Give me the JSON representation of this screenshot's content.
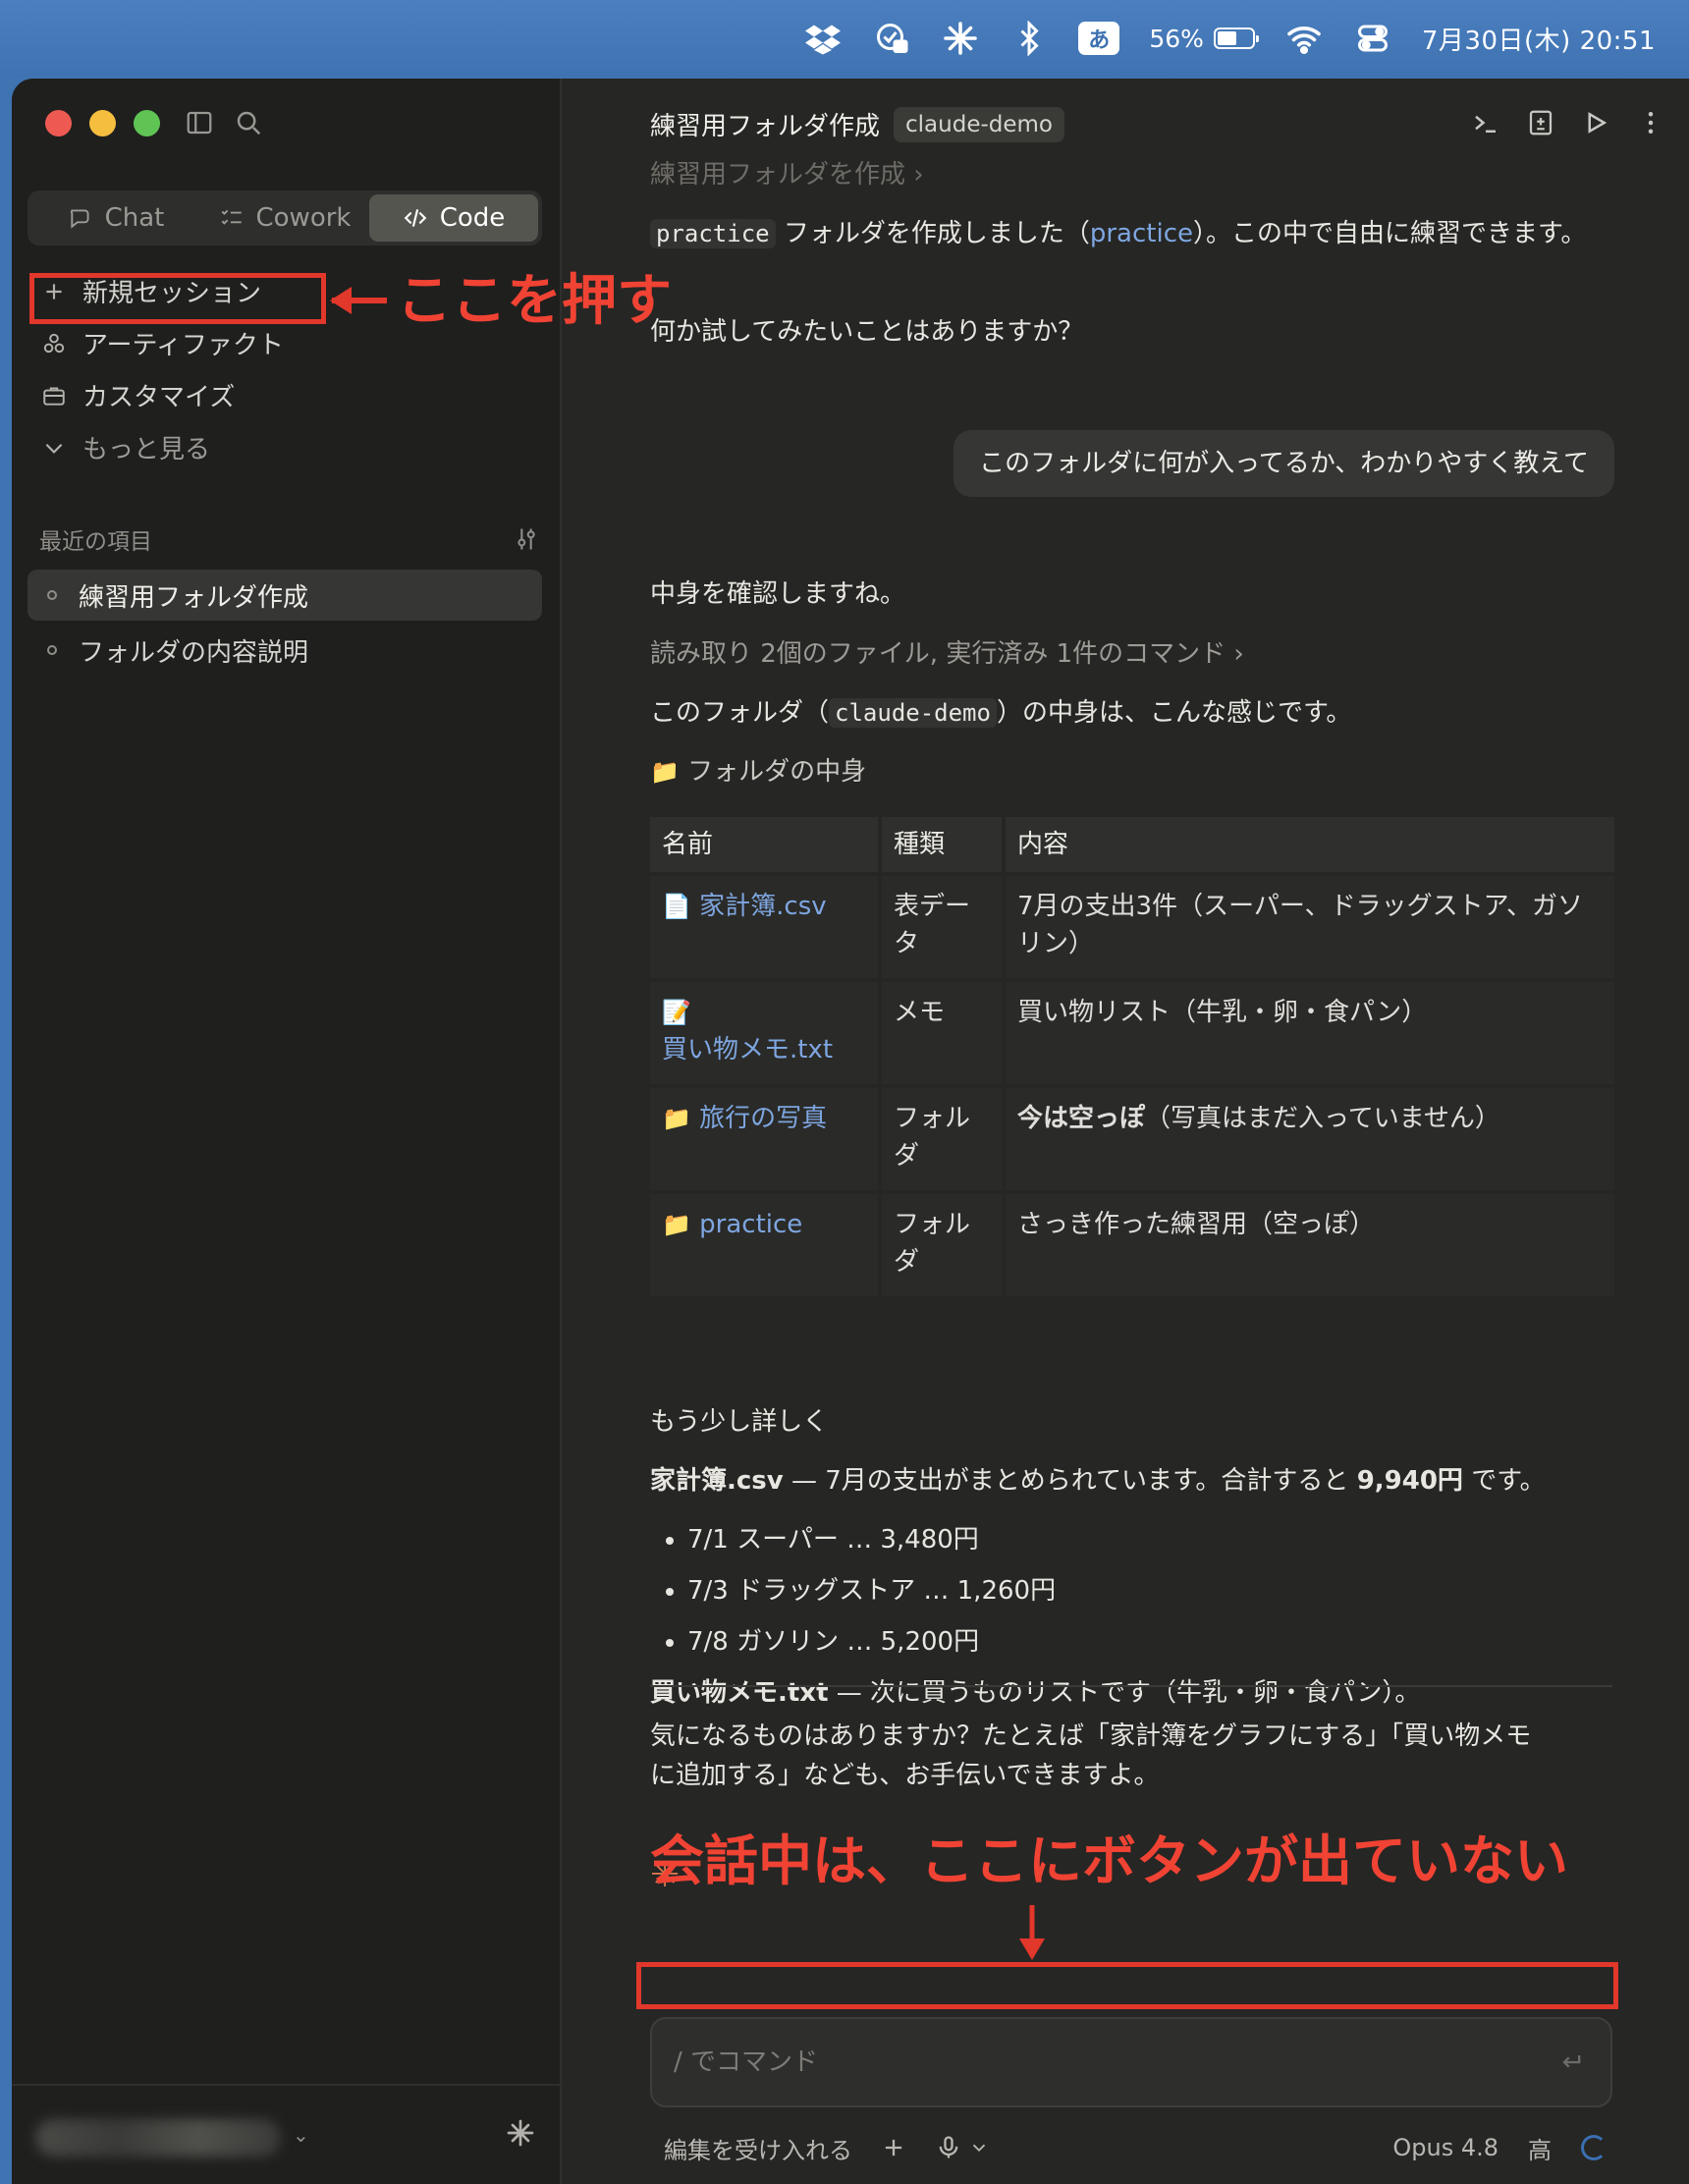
{
  "menubar": {
    "input_method": "あ",
    "battery_percent": "56%",
    "battery_level": 0.56,
    "clock": "7月30日(木) 20:51",
    "icons": [
      "dropbox-icon",
      "location-lock-icon",
      "claude-spark-icon",
      "bluetooth-icon",
      "input-method-icon",
      "battery-icon",
      "wifi-icon",
      "control-center-icon"
    ]
  },
  "sidebar": {
    "modes": [
      {
        "label": "Chat",
        "icon": "chat-bubble-icon"
      },
      {
        "label": "Cowork",
        "icon": "checklist-icon"
      },
      {
        "label": "Code",
        "icon": "code-icon",
        "active": true
      }
    ],
    "nav": [
      {
        "label": "新規セッション",
        "icon": "plus-icon"
      },
      {
        "label": "アーティファクト",
        "icon": "artifacts-icon"
      },
      {
        "label": "カスタマイズ",
        "icon": "briefcase-icon"
      },
      {
        "label": "もっと見る",
        "icon": "chevron-down-icon"
      }
    ],
    "recent_heading": "最近の項目",
    "recent": [
      {
        "label": "練習用フォルダ作成",
        "active": true
      },
      {
        "label": "フォルダの内容説明"
      }
    ]
  },
  "annotations": {
    "top": "ここを押す",
    "bottom": "会話中は、ここにボタンが出ていない",
    "color": "#e2372b"
  },
  "header": {
    "title": "練習用フォルダ作成",
    "project_chip": "claude-demo"
  },
  "conversation": {
    "faded_prev": "練習用フォルダを作成 ›",
    "msg1_code": "practice",
    "msg1_mid": " フォルダを作成しました（",
    "msg1_link": "practice",
    "msg1_end": "）。この中で自由に練習できます。",
    "msg2": "何か試してみたいことはありますか？",
    "user_msg": "このフォルダに何が入ってるか、わかりやすく教えて",
    "reply_intro": "中身を確認しますね。",
    "tool_summary": "読み取り 2個のファイル, 実行済み 1件のコマンド ›",
    "desc_pre": "このフォルダ（",
    "desc_code": "claude-demo",
    "desc_post": "）の中身は、こんな感じです。",
    "section_title": "フォルダの中身",
    "table": {
      "headers": [
        "名前",
        "種類",
        "内容"
      ],
      "rows": [
        {
          "icon": "📄",
          "name": "家計簿.csv",
          "type": "表データ",
          "content": "7月の支出3件（スーパー、ドラッグストア、ガソリン）"
        },
        {
          "icon": "📝",
          "name": "買い物メモ.txt",
          "type": "メモ",
          "content": "買い物リスト（牛乳・卵・食パン）"
        },
        {
          "icon": "📁",
          "name": "旅行の写真",
          "type": "フォルダ",
          "content_bold": "今は空っぽ",
          "content": "（写真はまだ入っていません）"
        },
        {
          "icon": "📁",
          "name": "practice",
          "type": "フォルダ",
          "content": "さっき作った練習用（空っぽ）"
        }
      ]
    },
    "detail_heading": "もう少し詳しく",
    "csv_name": "家計簿.csv",
    "csv_desc": " — 7月の支出がまとめられています。合計すると ",
    "csv_total": "9,940円",
    "csv_end": " です。",
    "expenses": [
      "7/1 スーパー … 3,480円",
      "7/3 ドラッグストア … 1,260円",
      "7/8 ガソリン … 5,200円"
    ],
    "memo_name": "買い物メモ.txt",
    "memo_desc": " — 次に買うものリストです（牛乳・卵・食パン）。",
    "closing_1": "気になるものはありますか？たとえば「家計簿をグラフにする」「買い物メモ",
    "closing_2": "に追加する」なども、お手伝いできますよ。"
  },
  "composer": {
    "placeholder": "/ でコマンド",
    "accept_edits": "編集を受け入れる",
    "model": "Opus 4.8",
    "effort": "高"
  }
}
